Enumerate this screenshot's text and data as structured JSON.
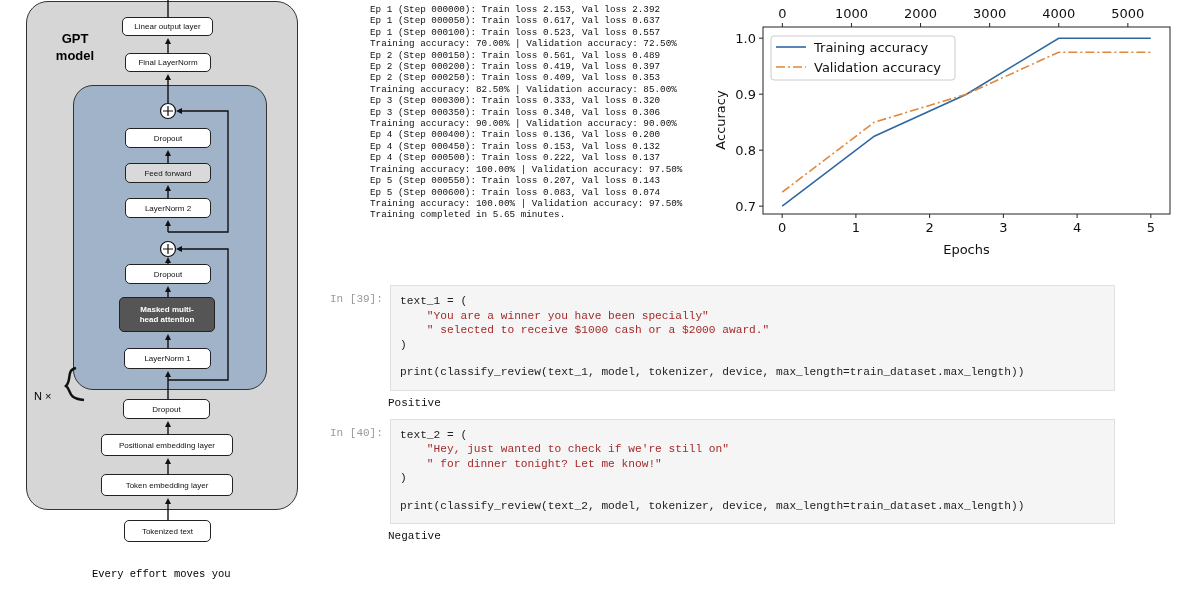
{
  "diagram": {
    "title": "GPT model",
    "repeat_label": "N ×",
    "input_text": "Every effort moves you",
    "nodes": [
      {
        "label": "Linear output layer",
        "kind": "plain"
      },
      {
        "label": "Final LayerNorm",
        "kind": "plain"
      },
      {
        "label": "Dropout",
        "kind": "plain"
      },
      {
        "label": "Feed forward",
        "kind": "shaded"
      },
      {
        "label": "LayerNorm 2",
        "kind": "plain"
      },
      {
        "label": "Dropout",
        "kind": "plain"
      },
      {
        "label": "Masked multi-head attention",
        "kind": "dark"
      },
      {
        "label": "LayerNorm 1",
        "kind": "plain"
      },
      {
        "label": "Dropout",
        "kind": "plain"
      },
      {
        "label": "Positional embedding layer",
        "kind": "plain"
      },
      {
        "label": "Token embedding layer",
        "kind": "plain"
      },
      {
        "label": "Tokenized text",
        "kind": "plain"
      }
    ]
  },
  "training_log": [
    "Ep 1 (Step 000000): Train loss 2.153, Val loss 2.392",
    "Ep 1 (Step 000050): Train loss 0.617, Val loss 0.637",
    "Ep 1 (Step 000100): Train loss 0.523, Val loss 0.557",
    "Training accuracy: 70.00% | Validation accuracy: 72.50%",
    "Ep 2 (Step 000150): Train loss 0.561, Val loss 0.489",
    "Ep 2 (Step 000200): Train loss 0.419, Val loss 0.397",
    "Ep 2 (Step 000250): Train loss 0.409, Val loss 0.353",
    "Training accuracy: 82.50% | Validation accuracy: 85.00%",
    "Ep 3 (Step 000300): Train loss 0.333, Val loss 0.320",
    "Ep 3 (Step 000350): Train loss 0.340, Val loss 0.306",
    "Training accuracy: 90.00% | Validation accuracy: 90.00%",
    "Ep 4 (Step 000400): Train loss 0.136, Val loss 0.200",
    "Ep 4 (Step 000450): Train loss 0.153, Val loss 0.132",
    "Ep 4 (Step 000500): Train loss 0.222, Val loss 0.137",
    "Training accuracy: 100.00% | Validation accuracy: 97.50%",
    "Ep 5 (Step 000550): Train loss 0.207, Val loss 0.143",
    "Ep 5 (Step 000600): Train loss 0.083, Val loss 0.074",
    "Training accuracy: 100.00% | Validation accuracy: 97.50%",
    "Training completed in 5.65 minutes."
  ],
  "chart": {
    "chart_data": {
      "type": "line",
      "xlabel": "Epochs",
      "ylabel": "Accuracy",
      "x": [
        0,
        1.25,
        2.5,
        3.75,
        5
      ],
      "series": [
        {
          "name": "Training accuracy",
          "color": "#2f67a0",
          "line_style": "solid",
          "values": [
            0.7,
            0.825,
            0.9,
            1.0,
            1.0
          ]
        },
        {
          "name": "Validation accuracy",
          "color": "#e0883a",
          "line_style": "dashdot",
          "values": [
            0.725,
            0.85,
            0.9,
            0.975,
            0.975
          ]
        }
      ],
      "legend": true,
      "xlim": [
        -0.26,
        5.26
      ],
      "ylim": [
        0.686,
        1.02
      ],
      "xticks": [
        0,
        1,
        2,
        3,
        4,
        5
      ],
      "yticks": [
        {
          "value": 0.7,
          "label": "0.7"
        },
        {
          "value": 0.8,
          "label": "0.8"
        },
        {
          "value": 0.9,
          "label": "0.9"
        },
        {
          "value": 1.0,
          "label": "1.0"
        }
      ]
    },
    "top_axis": {
      "ticks": [
        "0",
        "1000",
        "2000",
        "3000",
        "4000",
        "5000"
      ]
    }
  },
  "cells": [
    {
      "prompt": "In [39]:",
      "lines": [
        {
          "text": "text_1 = (",
          "kind": "code"
        },
        {
          "text": "    \"You are a winner you have been specially\"",
          "kind": "string"
        },
        {
          "text": "    \" selected to receive $1000 cash or a $2000 award.\"",
          "kind": "string"
        },
        {
          "text": ")",
          "kind": "code"
        }
      ],
      "call": "print(classify_review(text_1, model, tokenizer, device, max_length=train_dataset.max_length))",
      "output": "Positive"
    },
    {
      "prompt": "In [40]:",
      "lines": [
        {
          "text": "text_2 = (",
          "kind": "code"
        },
        {
          "text": "    \"Hey, just wanted to check if we're still on\"",
          "kind": "string"
        },
        {
          "text": "    \" for dinner tonight? Let me know!\"",
          "kind": "string"
        },
        {
          "text": ")",
          "kind": "code"
        }
      ],
      "call": "print(classify_review(text_2, model, tokenizer, device, max_length=train_dataset.max_length))",
      "output": "Negative"
    }
  ]
}
